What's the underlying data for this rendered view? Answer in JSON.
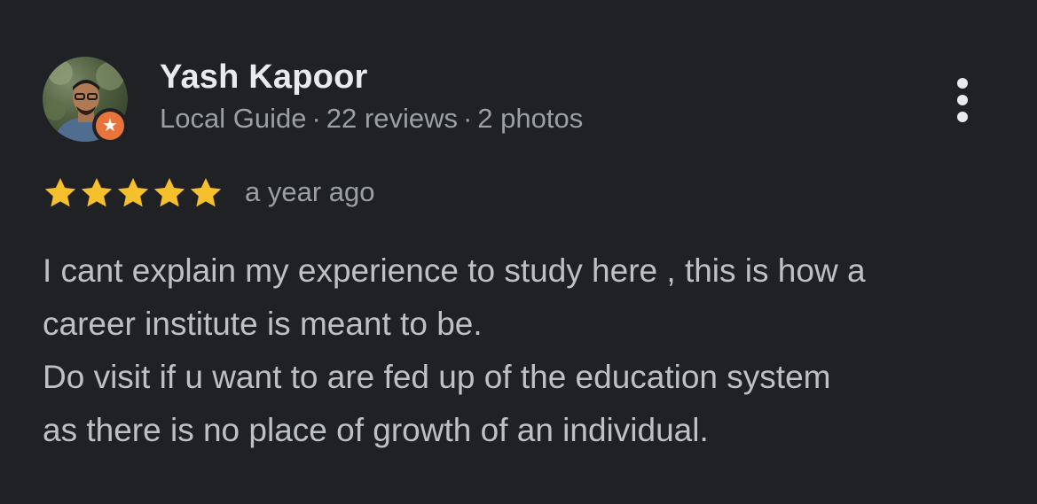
{
  "review": {
    "author": {
      "name": "Yash Kapoor",
      "badge": "Local Guide",
      "separator": "·",
      "reviews": "22 reviews",
      "photos": "2 photos",
      "avatar_icon": "profile-photo",
      "badge_icon": "local-guide-star-icon"
    },
    "rating": {
      "stars": 5,
      "max": 5,
      "star_color": "#f5c02b"
    },
    "time": "a year ago",
    "text_lines": [
      "I cant explain my experience to study here , this is how a",
      "career institute is meant to be.",
      "Do visit if u want to are fed up of the education system",
      "as there is no place of growth of an individual."
    ],
    "more_icon": "more-vert-icon"
  },
  "colors": {
    "background": "#202124",
    "primary_text": "#e8eaed",
    "secondary_text": "#9aa0a6",
    "body_text": "#bdc1c6",
    "guide_badge": "#e8743b"
  }
}
